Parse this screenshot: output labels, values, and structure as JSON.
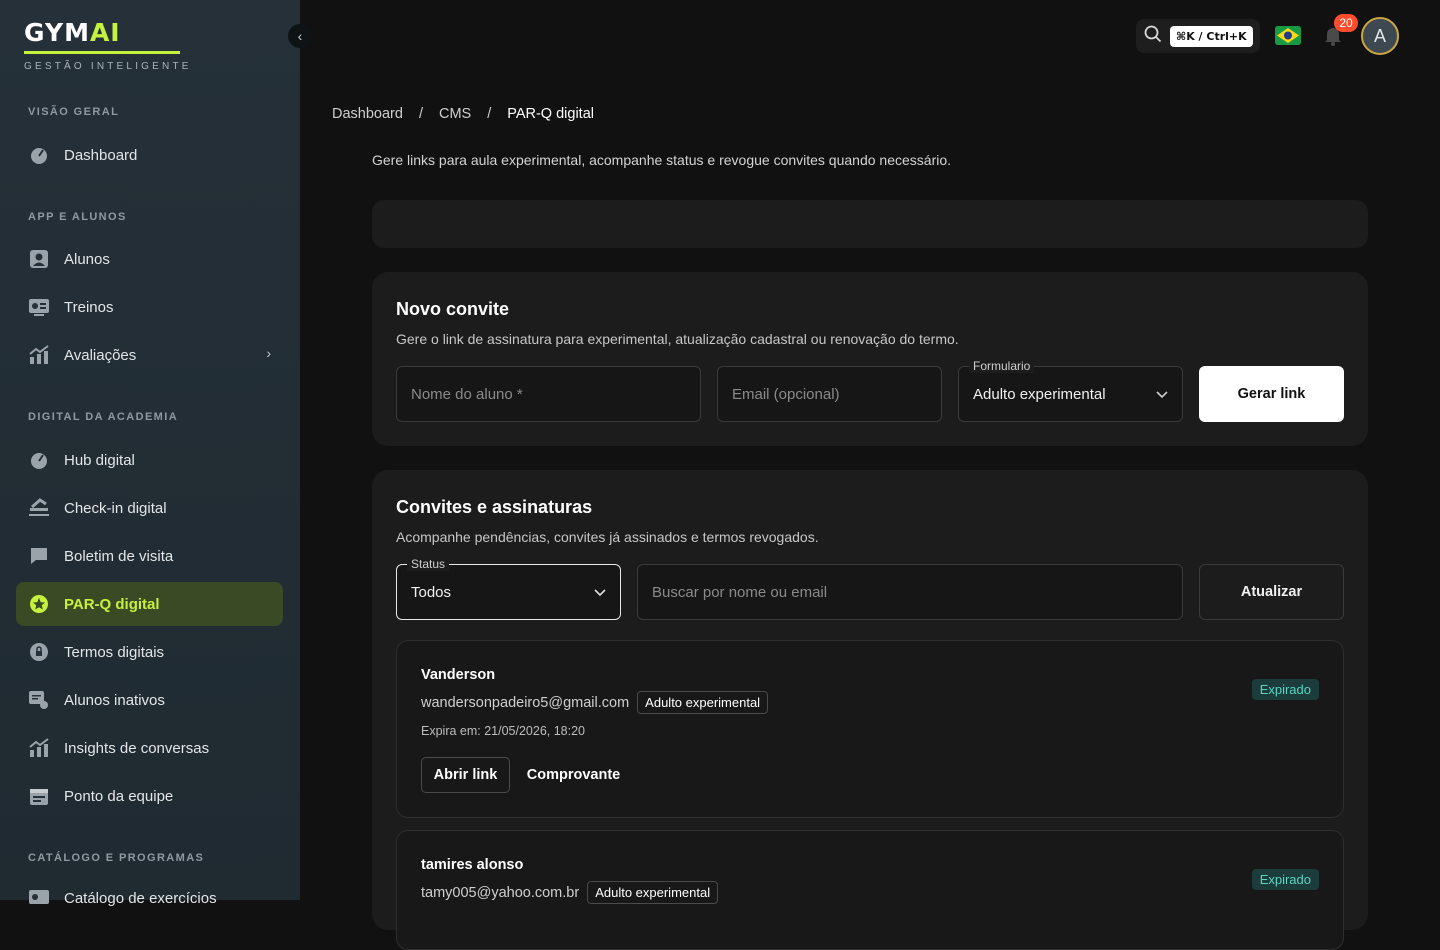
{
  "brand": {
    "name_main": "GYM",
    "name_accent": "AI",
    "tagline": "GESTÃO INTELIGENTE"
  },
  "sidebar": {
    "sections": [
      {
        "title": "VISÃO GERAL"
      },
      {
        "title": "APP E ALUNOS"
      },
      {
        "title": "DIGITAL DA ACADEMIA"
      },
      {
        "title": "CATÁLOGO E PROGRAMAS"
      }
    ],
    "items": [
      {
        "label": "Dashboard",
        "icon": "dashboard-icon"
      },
      {
        "label": "Alunos",
        "icon": "person-icon"
      },
      {
        "label": "Treinos",
        "icon": "workout-icon"
      },
      {
        "label": "Avaliações",
        "icon": "chart-icon"
      },
      {
        "label": "Hub digital",
        "icon": "hub-icon"
      },
      {
        "label": "Check-in digital",
        "icon": "checkin-icon"
      },
      {
        "label": "Boletim de visita",
        "icon": "report-icon"
      },
      {
        "label": "PAR-Q digital",
        "icon": "star-badge-icon",
        "active": true
      },
      {
        "label": "Termos digitais",
        "icon": "lock-icon"
      },
      {
        "label": "Alunos inativos",
        "icon": "inactive-icon"
      },
      {
        "label": "Insights de conversas",
        "icon": "insights-icon"
      },
      {
        "label": "Ponto da equipe",
        "icon": "calendar-icon"
      },
      {
        "label": "Catálogo de exercícios",
        "icon": "catalog-icon"
      }
    ]
  },
  "topbar": {
    "shortcut": "⌘K / Ctrl+K",
    "notifications": "20",
    "avatar_letter": "A"
  },
  "breadcrumb": {
    "items": [
      "Dashboard",
      "CMS",
      "PAR-Q digital"
    ],
    "separator": "/"
  },
  "page": {
    "subtitle": "Gere links para aula experimental, acompanhe status e revogue convites quando necessário."
  },
  "new_invite": {
    "title": "Novo convite",
    "description": "Gere o link de assinatura para experimental, atualização cadastral ou renovação do termo.",
    "name_placeholder": "Nome do aluno *",
    "email_placeholder": "Email (opcional)",
    "form_label": "Formulario",
    "form_value": "Adulto experimental",
    "generate_label": "Gerar link"
  },
  "invites": {
    "title": "Convites e assinaturas",
    "description": "Acompanhe pendências, convites já assinados e termos revogados.",
    "status_label": "Status",
    "status_value": "Todos",
    "search_placeholder": "Buscar por nome ou email",
    "refresh_label": "Atualizar",
    "items": [
      {
        "name": "Vanderson",
        "email": "wandersonpadeiro5@gmail.com",
        "form": "Adulto experimental",
        "expires": "Expira em: 21/05/2026, 18:20",
        "status": "Expirado",
        "open_label": "Abrir link",
        "receipt_label": "Comprovante"
      },
      {
        "name": "tamires alonso",
        "email": "tamy005@yahoo.com.br",
        "form": "Adulto experimental",
        "status": "Expirado"
      }
    ]
  },
  "colors": {
    "accent": "#c5f23c",
    "status_expired": "#59d5c2"
  }
}
